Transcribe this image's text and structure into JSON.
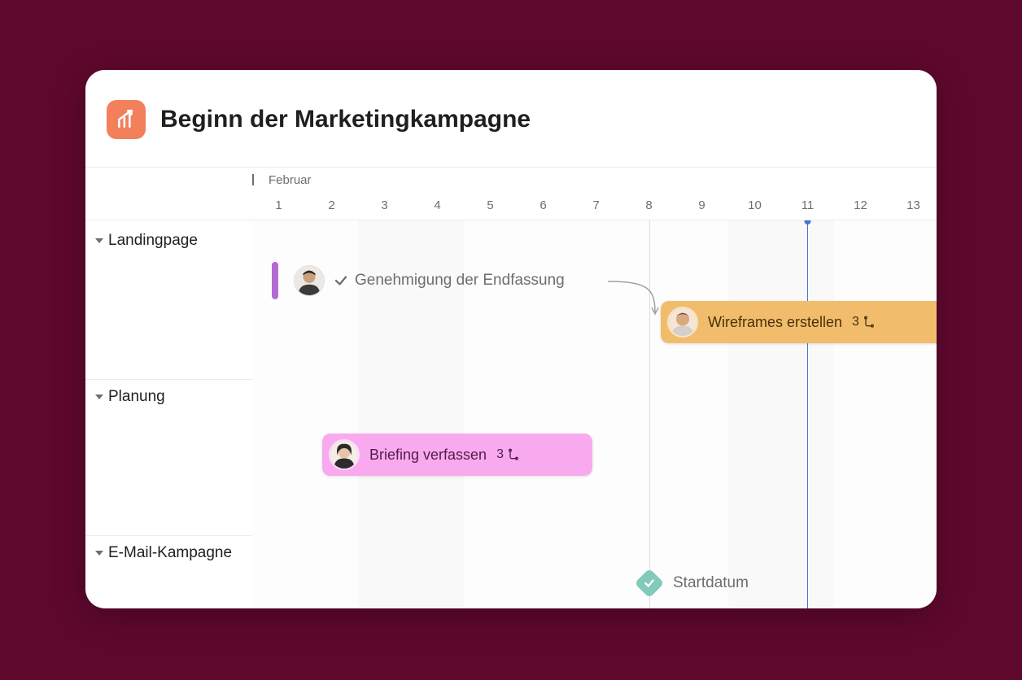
{
  "project": {
    "title": "Beginn der Marketingkampagne"
  },
  "timeline": {
    "month": "Februar",
    "days": [
      "1",
      "2",
      "3",
      "4",
      "5",
      "6",
      "7",
      "8",
      "9",
      "10",
      "11",
      "12",
      "13"
    ],
    "today_index": 10
  },
  "sections": [
    {
      "name": "Landingpage"
    },
    {
      "name": "Planung"
    },
    {
      "name": "E-Mail-Kampagne"
    }
  ],
  "tasks": {
    "approval": {
      "label": "Genehmigung der Endfassung",
      "completed": true
    },
    "wireframes": {
      "label": "Wireframes erstellen",
      "subtasks": "3"
    },
    "briefing": {
      "label": "Briefing verfassen",
      "subtasks": "3"
    }
  },
  "milestone": {
    "label": "Startdatum"
  },
  "avatars": {
    "a": {
      "skin": "#caa17a",
      "hair": "#2b2b2b"
    },
    "b": {
      "skin": "#d9a97f",
      "hair": "#1a1a1a"
    },
    "c": {
      "skin": "#e9c4a8",
      "hair": "#2b2b2b"
    }
  }
}
